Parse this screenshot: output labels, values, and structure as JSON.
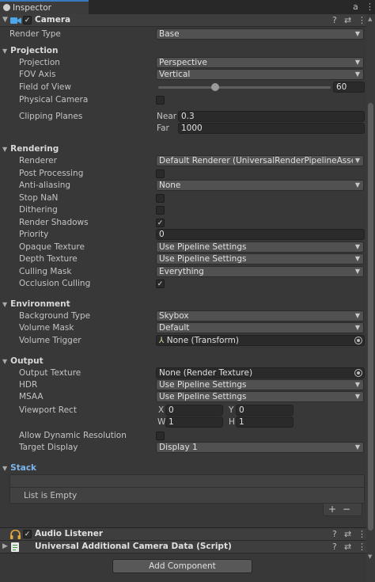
{
  "tab": {
    "label": "Inspector",
    "lock": "a",
    "menu": "⋮"
  },
  "components": {
    "camera": {
      "title": "Camera",
      "enabled": "✓"
    },
    "audio_listener": {
      "title": "Audio Listener",
      "enabled": "✓"
    },
    "additional_data": {
      "title": "Universal Additional Camera Data (Script)"
    }
  },
  "header_tools": {
    "help": "?",
    "presets": "⇄",
    "more": "⋮"
  },
  "camera": {
    "render_type": {
      "label": "Render Type",
      "value": "Base"
    },
    "projection_section": "Projection",
    "projection": {
      "label": "Projection",
      "value": "Perspective"
    },
    "fov_axis": {
      "label": "FOV Axis",
      "value": "Vertical"
    },
    "field_of_view": {
      "label": "Field of View",
      "value": "60",
      "fraction": 0.33
    },
    "physical_camera": {
      "label": "Physical Camera"
    },
    "clipping_planes": {
      "label": "Clipping Planes",
      "near_label": "Near",
      "near": "0.3",
      "far_label": "Far",
      "far": "1000"
    },
    "rendering_section": "Rendering",
    "renderer": {
      "label": "Renderer",
      "value": "Default Renderer (UniversalRenderPipelineAsset_Renderer)"
    },
    "post_processing": {
      "label": "Post Processing"
    },
    "anti_aliasing": {
      "label": "Anti-aliasing",
      "value": "None"
    },
    "stop_nan": {
      "label": "Stop NaN"
    },
    "dithering": {
      "label": "Dithering"
    },
    "render_shadows": {
      "label": "Render Shadows",
      "check": "✓"
    },
    "priority": {
      "label": "Priority",
      "value": "0"
    },
    "opaque_texture": {
      "label": "Opaque Texture",
      "value": "Use Pipeline Settings"
    },
    "depth_texture": {
      "label": "Depth Texture",
      "value": "Use Pipeline Settings"
    },
    "culling_mask": {
      "label": "Culling Mask",
      "value": "Everything"
    },
    "occlusion_culling": {
      "label": "Occlusion Culling",
      "check": "✓"
    },
    "environment_section": "Environment",
    "background_type": {
      "label": "Background Type",
      "value": "Skybox"
    },
    "volume_mask": {
      "label": "Volume Mask",
      "value": "Default"
    },
    "volume_trigger": {
      "label": "Volume Trigger",
      "value": "None (Transform)",
      "icon": "⅄"
    },
    "output_section": "Output",
    "output_texture": {
      "label": "Output Texture",
      "value": "None (Render Texture)"
    },
    "hdr": {
      "label": "HDR",
      "value": "Use Pipeline Settings"
    },
    "msaa": {
      "label": "MSAA",
      "value": "Use Pipeline Settings"
    },
    "viewport_rect": {
      "label": "Viewport Rect",
      "x_label": "X",
      "x": "0",
      "y_label": "Y",
      "y": "0",
      "w_label": "W",
      "w": "1",
      "h_label": "H",
      "h": "1"
    },
    "allow_dynamic_resolution": {
      "label": "Allow Dynamic Resolution"
    },
    "target_display": {
      "label": "Target Display",
      "value": "Display 1"
    },
    "stack_section": "Stack",
    "stack_empty": "List is Empty",
    "stack_add": "+",
    "stack_remove": "−"
  },
  "add_component": "Add Component",
  "icons": {
    "fold_open": "▼",
    "fold_closed": "▶",
    "dropdown": "▼",
    "scroll_up": "▲",
    "scroll_down": "▼"
  },
  "colors": {
    "background": "#383838",
    "accent": "#3a79bb",
    "field": "#2a2a2a",
    "dropdown": "#515151"
  }
}
